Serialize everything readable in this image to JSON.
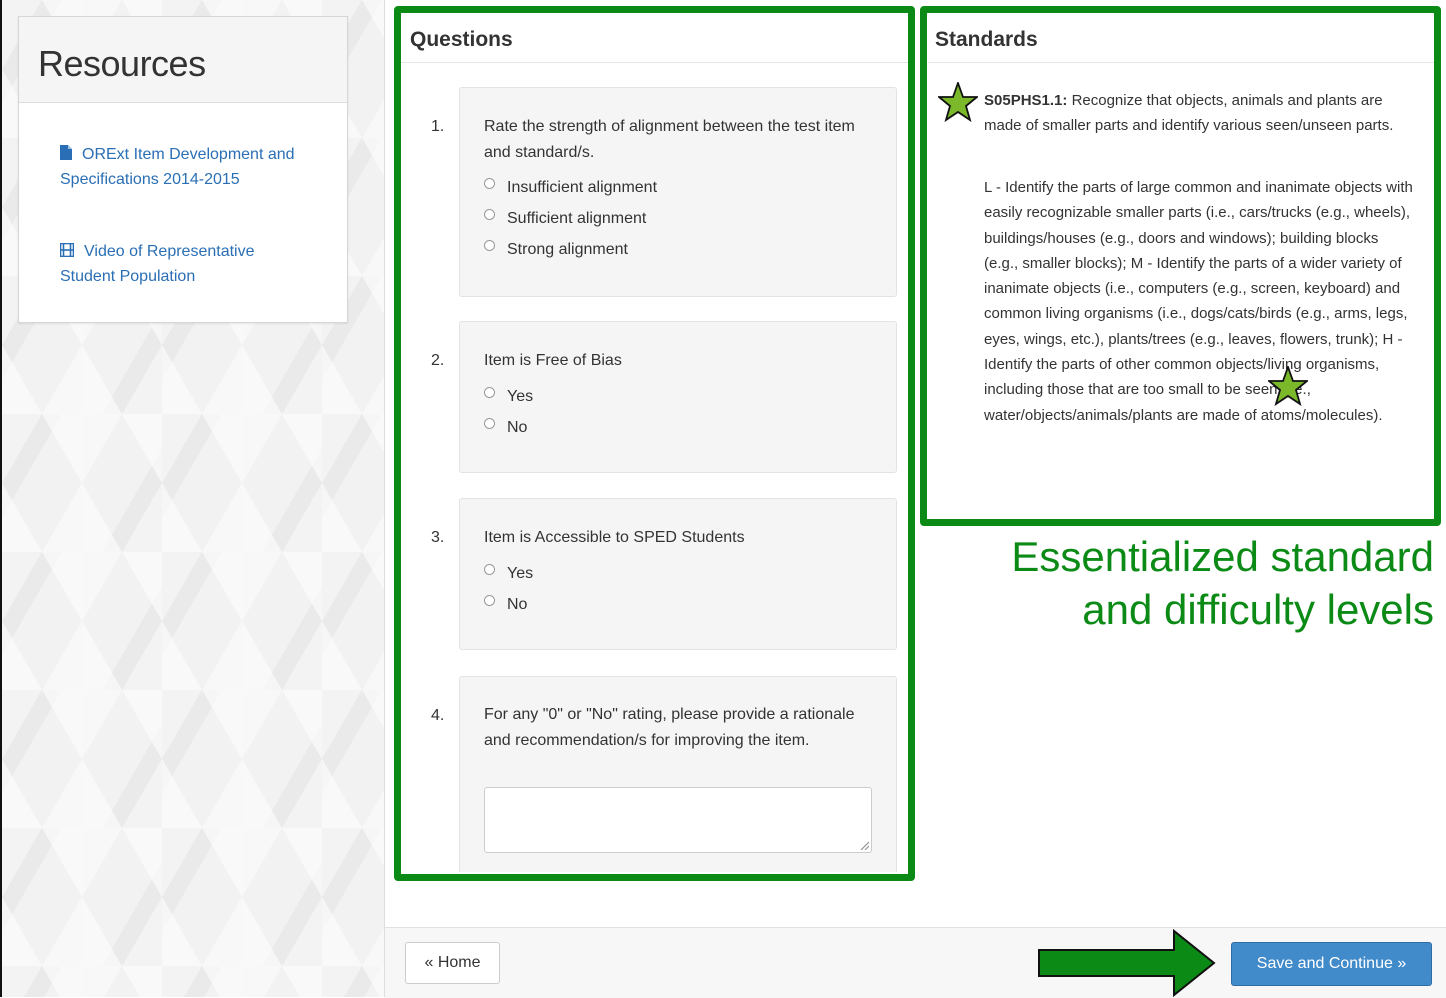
{
  "resources": {
    "title": "Resources",
    "links": [
      {
        "label": "ORExt Item Development and Specifications 2014-2015",
        "icon": "document-icon"
      },
      {
        "label": "Video of Representative Student Population",
        "icon": "film-icon"
      }
    ]
  },
  "questions": {
    "heading": "Questions",
    "items": [
      {
        "number": "1.",
        "text": "Rate the strength of alignment between the test item and standard/s.",
        "options": [
          "Insufficient alignment",
          "Sufficient alignment",
          "Strong alignment"
        ]
      },
      {
        "number": "2.",
        "text": "Item is Free of Bias",
        "options": [
          "Yes",
          "No"
        ]
      },
      {
        "number": "3.",
        "text": "Item is Accessible to SPED Students",
        "options": [
          "Yes",
          "No"
        ]
      },
      {
        "number": "4.",
        "text": "For any \"0\" or \"No\" rating, please provide a rationale and recommendation/s for improving the item.",
        "textarea_value": ""
      }
    ]
  },
  "standards": {
    "heading": "Standards",
    "code": "S05PHS1.1:",
    "description": "Recognize that objects, animals and plants are made of smaller parts and identify various seen/unseen parts.",
    "levels_text": "L - Identify the parts of large common and inanimate objects with easily recognizable smaller parts (i.e., cars/trucks (e.g., wheels), buildings/houses (e.g., doors and windows); building blocks (e.g., smaller blocks); M - Identify the parts of a wider variety of inanimate objects (i.e., computers (e.g., screen, keyboard) and common living organisms (i.e., dogs/cats/birds (e.g., arms, legs, eyes, wings, etc.), plants/trees (e.g., leaves, flowers, trunk); H - Identify the parts of other common objects/living organisms, including those that are too small to be seen (i.e., water/objects/animals/plants are made of atoms/molecules)."
  },
  "annotation": {
    "caption_line1": "Essentialized standard",
    "caption_line2": "and difficulty levels",
    "highlight_color": "#0c8a16",
    "star_color": "#7bb82a"
  },
  "footer": {
    "home_label": "« Home",
    "save_label": "Save and Continue »"
  }
}
